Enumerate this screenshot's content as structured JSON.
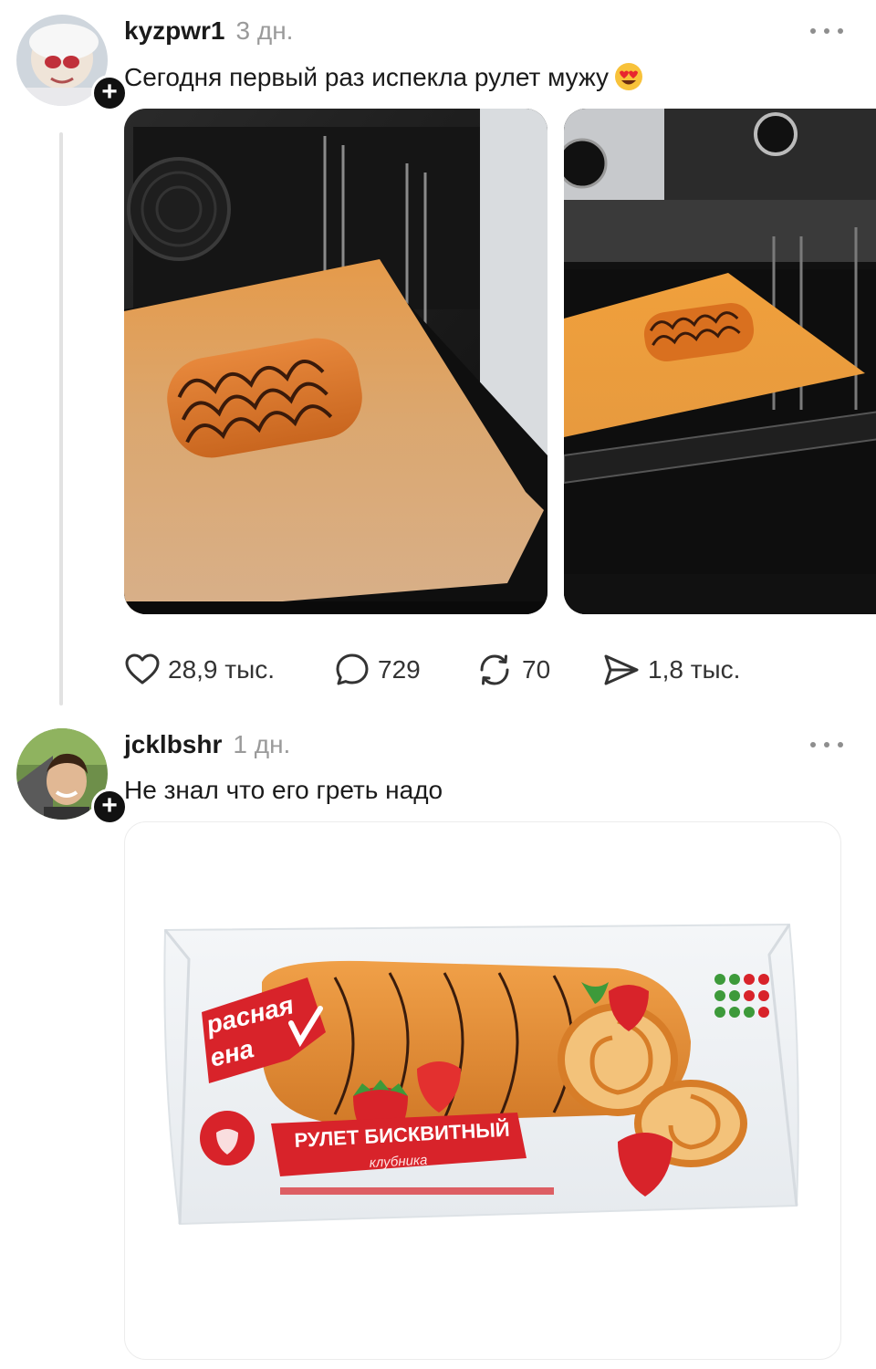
{
  "posts": [
    {
      "username": "kyzpwr1",
      "time": "3 дн.",
      "text": "Сегодня первый раз испекла рулет мужу",
      "emoji_icon": "heart-eyes-emoji",
      "actions": {
        "likes": "28,9 тыс.",
        "comments": "729",
        "reposts": "70",
        "shares": "1,8 тыс."
      }
    },
    {
      "username": "jcklbshr",
      "time": "1 дн.",
      "text": "Не знал что его греть надо",
      "package": {
        "brand_line1": "расная",
        "brand_line2": "ена",
        "product": "РУЛЕТ БИСКВИТНЫЙ",
        "flavor": "клубника"
      }
    }
  ],
  "colors": {
    "accent": "#111111",
    "muted": "#9a9a9a",
    "parchment": "#d9a56b",
    "brand_red": "#d8232a"
  }
}
